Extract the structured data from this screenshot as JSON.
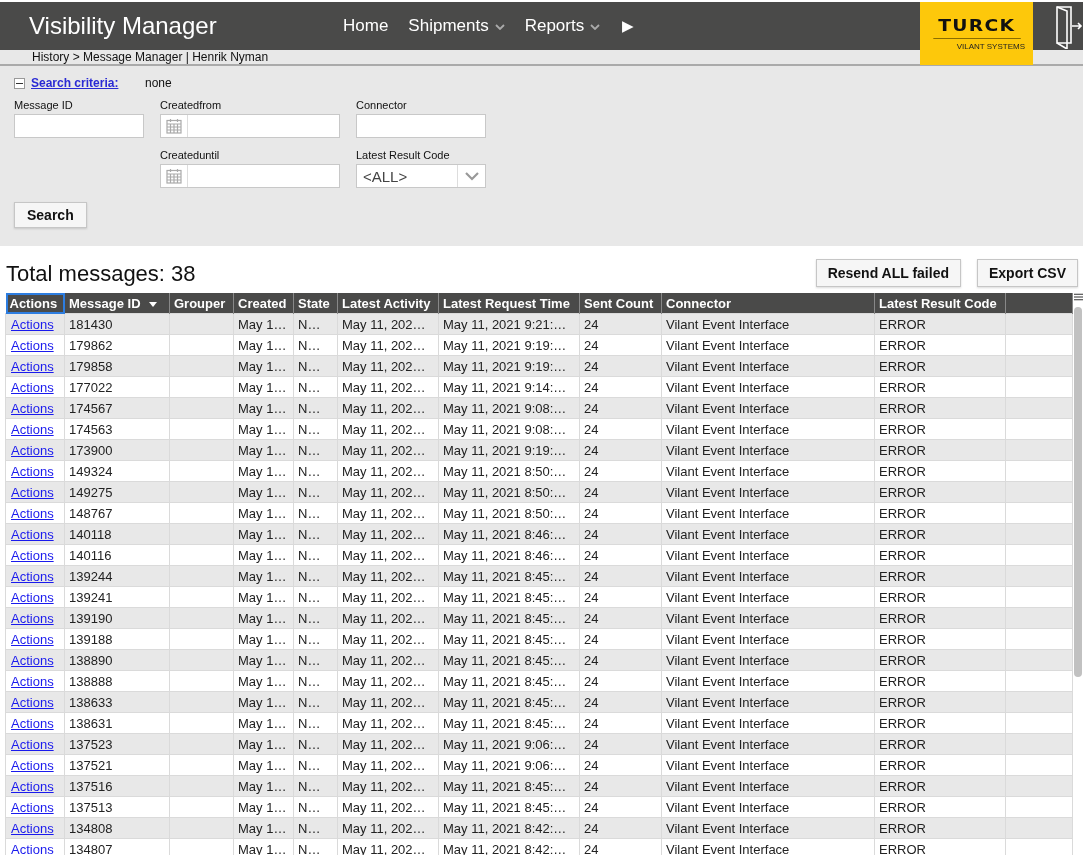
{
  "header": {
    "title": "Visibility Manager",
    "nav": [
      {
        "label": "Home",
        "dropdown": false
      },
      {
        "label": "Shipments",
        "dropdown": true
      },
      {
        "label": "Reports",
        "dropdown": true
      }
    ],
    "more": "▶",
    "logo": {
      "word": "TURCK",
      "sub": "VILANT SYSTEMS"
    }
  },
  "breadcrumb": "History > Message Manager | Henrik Nyman",
  "search": {
    "expanded": true,
    "criteria_label": "Search criteria:",
    "criteria_value": "none",
    "fields": [
      {
        "label": "Message ID",
        "kind": "text"
      },
      {
        "label": "Createdfrom",
        "kind": "date"
      },
      {
        "label": "Connector",
        "kind": "text"
      },
      {
        "label": "Createduntil",
        "kind": "date"
      },
      {
        "label": "Latest Result Code",
        "kind": "select",
        "value": "<ALL>"
      }
    ],
    "button": "Search"
  },
  "total": "Total messages: 38",
  "buttons": [
    "Resend ALL failed",
    "Export CSV"
  ],
  "table": {
    "columns": [
      {
        "label": "Actions",
        "sorted": false,
        "selected": true
      },
      {
        "label": "Message ID",
        "sorted": true,
        "selected": false
      },
      {
        "label": "Grouper",
        "sorted": false,
        "selected": false
      },
      {
        "label": "Created",
        "sorted": false,
        "selected": false
      },
      {
        "label": "State",
        "sorted": false,
        "selected": false
      },
      {
        "label": "Latest Activity",
        "sorted": false,
        "selected": false
      },
      {
        "label": "Latest Request Time",
        "sorted": false,
        "selected": false
      },
      {
        "label": "Sent Count",
        "sorted": false,
        "selected": false
      },
      {
        "label": "Connector",
        "sorted": false,
        "selected": false
      },
      {
        "label": "Latest Result Code",
        "sorted": false,
        "selected": false
      }
    ],
    "rows": [
      [
        "Actions",
        "181430",
        "",
        "May 1…",
        "N…",
        "May 11, 202…",
        "May 11, 2021 9:21:…",
        "24",
        "Vilant Event Interface",
        "ERROR"
      ],
      [
        "Actions",
        "179862",
        "",
        "May 1…",
        "N…",
        "May 11, 202…",
        "May 11, 2021 9:19:…",
        "24",
        "Vilant Event Interface",
        "ERROR"
      ],
      [
        "Actions",
        "179858",
        "",
        "May 1…",
        "N…",
        "May 11, 202…",
        "May 11, 2021 9:19:…",
        "24",
        "Vilant Event Interface",
        "ERROR"
      ],
      [
        "Actions",
        "177022",
        "",
        "May 1…",
        "N…",
        "May 11, 202…",
        "May 11, 2021 9:14:…",
        "24",
        "Vilant Event Interface",
        "ERROR"
      ],
      [
        "Actions",
        "174567",
        "",
        "May 1…",
        "N…",
        "May 11, 202…",
        "May 11, 2021 9:08:…",
        "24",
        "Vilant Event Interface",
        "ERROR"
      ],
      [
        "Actions",
        "174563",
        "",
        "May 1…",
        "N…",
        "May 11, 202…",
        "May 11, 2021 9:08:…",
        "24",
        "Vilant Event Interface",
        "ERROR"
      ],
      [
        "Actions",
        "173900",
        "",
        "May 1…",
        "N…",
        "May 11, 202…",
        "May 11, 2021 9:19:…",
        "24",
        "Vilant Event Interface",
        "ERROR"
      ],
      [
        "Actions",
        "149324",
        "",
        "May 1…",
        "N…",
        "May 11, 202…",
        "May 11, 2021 8:50:…",
        "24",
        "Vilant Event Interface",
        "ERROR"
      ],
      [
        "Actions",
        "149275",
        "",
        "May 1…",
        "N…",
        "May 11, 202…",
        "May 11, 2021 8:50:…",
        "24",
        "Vilant Event Interface",
        "ERROR"
      ],
      [
        "Actions",
        "148767",
        "",
        "May 1…",
        "N…",
        "May 11, 202…",
        "May 11, 2021 8:50:…",
        "24",
        "Vilant Event Interface",
        "ERROR"
      ],
      [
        "Actions",
        "140118",
        "",
        "May 1…",
        "N…",
        "May 11, 202…",
        "May 11, 2021 8:46:…",
        "24",
        "Vilant Event Interface",
        "ERROR"
      ],
      [
        "Actions",
        "140116",
        "",
        "May 1…",
        "N…",
        "May 11, 202…",
        "May 11, 2021 8:46:…",
        "24",
        "Vilant Event Interface",
        "ERROR"
      ],
      [
        "Actions",
        "139244",
        "",
        "May 1…",
        "N…",
        "May 11, 202…",
        "May 11, 2021 8:45:…",
        "24",
        "Vilant Event Interface",
        "ERROR"
      ],
      [
        "Actions",
        "139241",
        "",
        "May 1…",
        "N…",
        "May 11, 202…",
        "May 11, 2021 8:45:…",
        "24",
        "Vilant Event Interface",
        "ERROR"
      ],
      [
        "Actions",
        "139190",
        "",
        "May 1…",
        "N…",
        "May 11, 202…",
        "May 11, 2021 8:45:…",
        "24",
        "Vilant Event Interface",
        "ERROR"
      ],
      [
        "Actions",
        "139188",
        "",
        "May 1…",
        "N…",
        "May 11, 202…",
        "May 11, 2021 8:45:…",
        "24",
        "Vilant Event Interface",
        "ERROR"
      ],
      [
        "Actions",
        "138890",
        "",
        "May 1…",
        "N…",
        "May 11, 202…",
        "May 11, 2021 8:45:…",
        "24",
        "Vilant Event Interface",
        "ERROR"
      ],
      [
        "Actions",
        "138888",
        "",
        "May 1…",
        "N…",
        "May 11, 202…",
        "May 11, 2021 8:45:…",
        "24",
        "Vilant Event Interface",
        "ERROR"
      ],
      [
        "Actions",
        "138633",
        "",
        "May 1…",
        "N…",
        "May 11, 202…",
        "May 11, 2021 8:45:…",
        "24",
        "Vilant Event Interface",
        "ERROR"
      ],
      [
        "Actions",
        "138631",
        "",
        "May 1…",
        "N…",
        "May 11, 202…",
        "May 11, 2021 8:45:…",
        "24",
        "Vilant Event Interface",
        "ERROR"
      ],
      [
        "Actions",
        "137523",
        "",
        "May 1…",
        "N…",
        "May 11, 202…",
        "May 11, 2021 9:06:…",
        "24",
        "Vilant Event Interface",
        "ERROR"
      ],
      [
        "Actions",
        "137521",
        "",
        "May 1…",
        "N…",
        "May 11, 202…",
        "May 11, 2021 9:06:…",
        "24",
        "Vilant Event Interface",
        "ERROR"
      ],
      [
        "Actions",
        "137516",
        "",
        "May 1…",
        "N…",
        "May 11, 202…",
        "May 11, 2021 8:45:…",
        "24",
        "Vilant Event Interface",
        "ERROR"
      ],
      [
        "Actions",
        "137513",
        "",
        "May 1…",
        "N…",
        "May 11, 202…",
        "May 11, 2021 8:45:…",
        "24",
        "Vilant Event Interface",
        "ERROR"
      ],
      [
        "Actions",
        "134808",
        "",
        "May 1…",
        "N…",
        "May 11, 202…",
        "May 11, 2021 8:42:…",
        "24",
        "Vilant Event Interface",
        "ERROR"
      ],
      [
        "Actions",
        "134807",
        "",
        "May 1…",
        "N…",
        "May 11, 202…",
        "May 11, 2021 8:42:…",
        "24",
        "Vilant Event Interface",
        "ERROR"
      ]
    ]
  }
}
